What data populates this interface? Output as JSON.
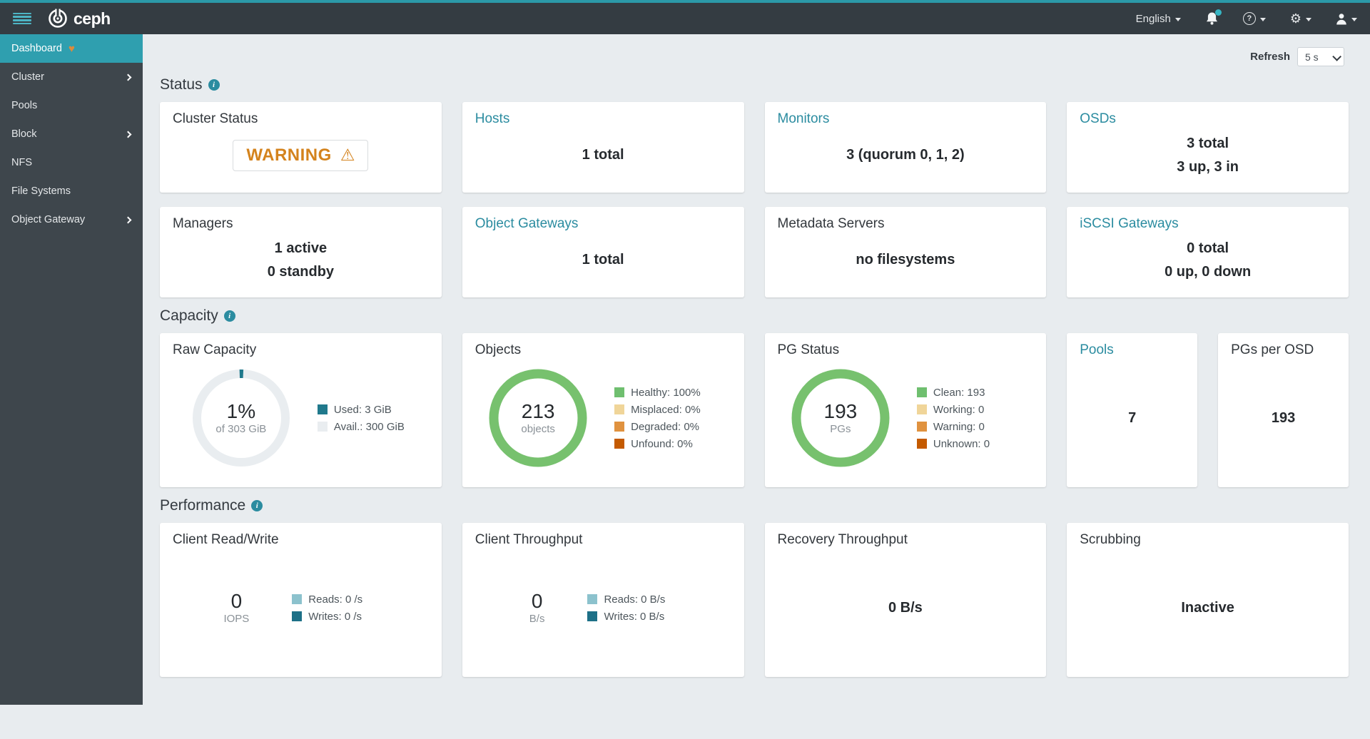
{
  "colors": {
    "accent": "#2b99a8",
    "warning_orange": "#d4831d",
    "donut_green": "#77c16e",
    "used_teal": "#20798c",
    "avail_gray": "#e9edf0",
    "reads_teal": "#8cc2cd",
    "writes_teal": "#1d7087"
  },
  "icons": {
    "gear_glyph": "⚙",
    "help_glyph": "?",
    "info_glyph": "i",
    "health_glyph": "♥",
    "warning_glyph": "⚠"
  },
  "navbar": {
    "brand": "ceph",
    "language": "English"
  },
  "sidebar": {
    "items": [
      {
        "label": "Dashboard"
      },
      {
        "label": "Cluster"
      },
      {
        "label": "Pools"
      },
      {
        "label": "Block"
      },
      {
        "label": "NFS"
      },
      {
        "label": "File Systems"
      },
      {
        "label": "Object Gateway"
      }
    ]
  },
  "toolbar": {
    "refresh_label": "Refresh",
    "refresh_value": "5 s"
  },
  "status": {
    "title": "Status",
    "cards": [
      {
        "title": "Cluster Status",
        "value": "WARNING"
      },
      {
        "title": "Hosts",
        "line1": "1 total"
      },
      {
        "title": "Monitors",
        "line1": "3 (quorum 0, 1, 2)"
      },
      {
        "title": "OSDs",
        "line1": "3 total",
        "line2": "3 up, 3 in"
      },
      {
        "title": "Managers",
        "line1": "1 active",
        "line2": "0 standby"
      },
      {
        "title": "Object Gateways",
        "line1": "1 total"
      },
      {
        "title": "Metadata Servers",
        "line1": "no filesystems"
      },
      {
        "title": "iSCSI Gateways",
        "line1": "0 total",
        "line2": "0 up, 0 down"
      }
    ]
  },
  "capacity": {
    "title": "Capacity",
    "raw": {
      "title": "Raw Capacity",
      "center": "1%",
      "sub": "of 303 GiB",
      "used_color": "#20798c",
      "avail_color": "#e9edf0",
      "legend": [
        {
          "label": "Used: 3 GiB",
          "color": "#20798c"
        },
        {
          "label": "Avail.: 300 GiB",
          "color": "#e9edf0"
        }
      ]
    },
    "objects": {
      "title": "Objects",
      "center": "213",
      "sub": "objects",
      "ring_color": "#77c16e",
      "legend": [
        {
          "label": "Healthy: 100%",
          "color": "#6fbf6f"
        },
        {
          "label": "Misplaced: 0%",
          "color": "#f0d599"
        },
        {
          "label": "Degraded: 0%",
          "color": "#e0923f"
        },
        {
          "label": "Unfound: 0%",
          "color": "#c45a00"
        }
      ]
    },
    "pg": {
      "title": "PG Status",
      "center": "193",
      "sub": "PGs",
      "ring_color": "#77c16e",
      "legend": [
        {
          "label": "Clean: 193",
          "color": "#6fbf6f"
        },
        {
          "label": "Working: 0",
          "color": "#f0d599"
        },
        {
          "label": "Warning: 0",
          "color": "#e0923f"
        },
        {
          "label": "Unknown: 0",
          "color": "#c45a00"
        }
      ]
    },
    "pools": {
      "title": "Pools",
      "value": "7"
    },
    "pgs_per_osd": {
      "title": "PGs per OSD",
      "value": "193"
    }
  },
  "performance": {
    "title": "Performance",
    "client_rw": {
      "title": "Client Read/Write",
      "center": "0",
      "sub": "IOPS",
      "legend": [
        {
          "label": "Reads: 0 /s",
          "color": "#8cc2cd"
        },
        {
          "label": "Writes: 0 /s",
          "color": "#1d7087"
        }
      ]
    },
    "client_tp": {
      "title": "Client Throughput",
      "center": "0",
      "sub": "B/s",
      "legend": [
        {
          "label": "Reads: 0 B/s",
          "color": "#8cc2cd"
        },
        {
          "label": "Writes: 0 B/s",
          "color": "#1d7087"
        }
      ]
    },
    "recovery": {
      "title": "Recovery Throughput",
      "value": "0 B/s"
    },
    "scrubbing": {
      "title": "Scrubbing",
      "value": "Inactive"
    }
  }
}
